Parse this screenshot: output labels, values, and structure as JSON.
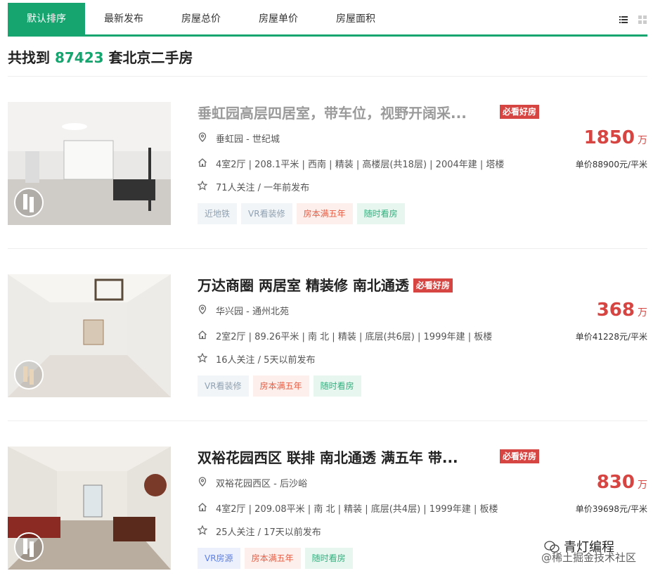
{
  "tabs": [
    {
      "label": "默认排序",
      "active": true
    },
    {
      "label": "最新发布",
      "active": false
    },
    {
      "label": "房屋总价",
      "active": false
    },
    {
      "label": "房屋单价",
      "active": false
    },
    {
      "label": "房屋面积",
      "active": false
    }
  ],
  "summary": {
    "prefix": "共找到 ",
    "count": "87423",
    "suffix": " 套北京二手房"
  },
  "listings": [
    {
      "title": "垂虹园高层四居室，带车位，视野开阔采...",
      "badge": "必看好房",
      "location": "垂虹园 - 世纪城",
      "info": "4室2厅 | 208.1平米 | 西南 | 精装 | 高楼层(共18层) | 2004年建 | 塔楼",
      "follow": "71人关注 / 一年前发布",
      "price": "1850",
      "price_unit": "万",
      "unit_price": "单价88900元/平米",
      "tags": [
        {
          "label": "近地铁",
          "style": "gray"
        },
        {
          "label": "VR看装修",
          "style": "gray"
        },
        {
          "label": "房本满五年",
          "style": "red"
        },
        {
          "label": "随时看房",
          "style": "green"
        }
      ]
    },
    {
      "title": "万达商圈 两居室 精装修 南北通透",
      "badge": "必看好房",
      "location": "华兴园 - 通州北苑",
      "info": "2室2厅 | 89.26平米 | 南 北 | 精装 | 底层(共6层) | 1999年建 | 板楼",
      "follow": "16人关注 / 5天以前发布",
      "price": "368",
      "price_unit": "万",
      "unit_price": "单价41228元/平米",
      "tags": [
        {
          "label": "VR看装修",
          "style": "gray"
        },
        {
          "label": "房本满五年",
          "style": "red"
        },
        {
          "label": "随时看房",
          "style": "green"
        }
      ]
    },
    {
      "title": "双裕花园西区 联排 南北通透 满五年 带...",
      "badge": "必看好房",
      "location": "双裕花园西区 - 后沙峪",
      "info": "4室2厅 | 209.08平米 | 南 北 | 精装 | 底层(共4层) | 1999年建 | 板楼",
      "follow": "25人关注 / 17天以前发布",
      "price": "830",
      "price_unit": "万",
      "unit_price": "单价39698元/平米",
      "tags": [
        {
          "label": "VR房源",
          "style": "blue"
        },
        {
          "label": "房本满五年",
          "style": "red"
        },
        {
          "label": "随时看房",
          "style": "green"
        }
      ]
    }
  ],
  "watermark": {
    "line1": "青灯编程",
    "line2": "@稀土掘金技术社区"
  },
  "colors": {
    "accent": "#16a56f",
    "price": "#d64541"
  }
}
